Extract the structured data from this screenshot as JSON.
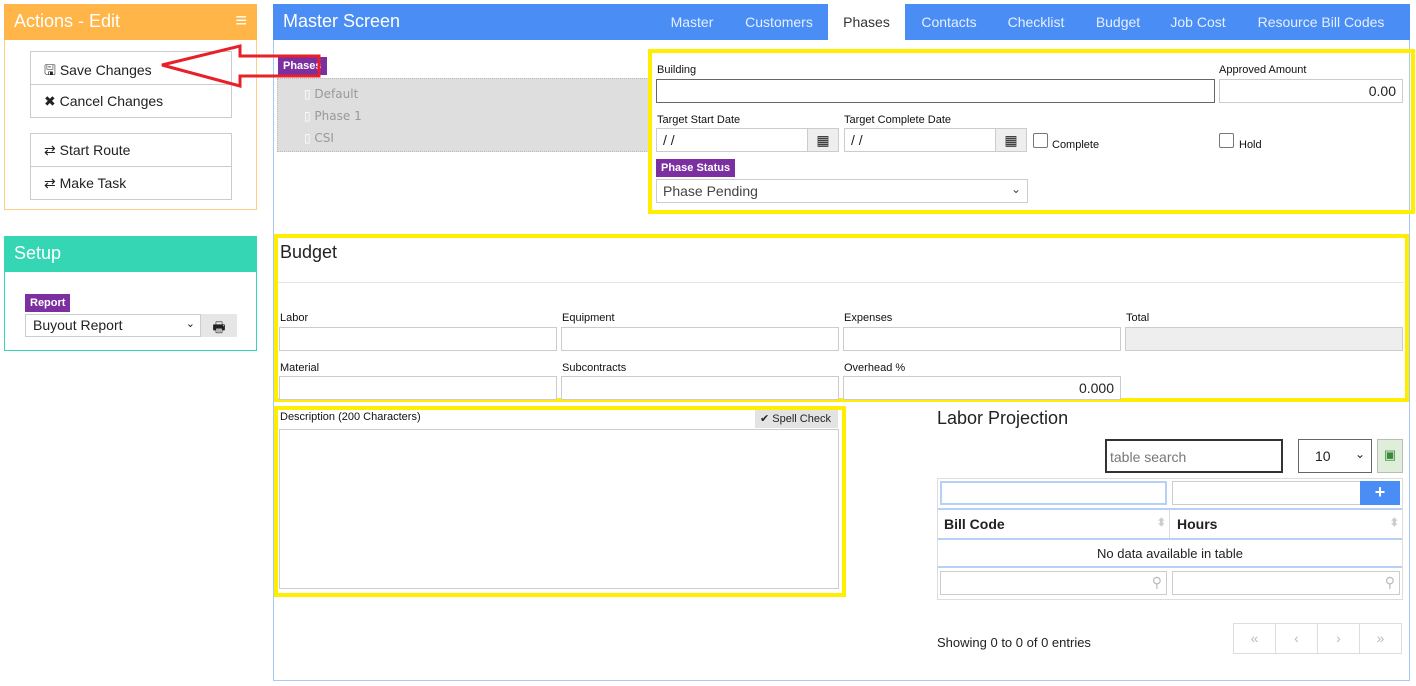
{
  "actions": {
    "title": "Actions - Edit",
    "buttons": [
      "Save Changes",
      "Cancel Changes",
      "Start Route",
      "Make Task"
    ],
    "color": "#ffb547"
  },
  "setup": {
    "title": "Setup",
    "report_label": "Report",
    "report_value": "Buyout Report",
    "color": "#35d6b4"
  },
  "main": {
    "title": "Master Screen",
    "color": "#4a8ef5",
    "tabs": [
      "Master",
      "Customers",
      "Phases",
      "Contacts",
      "Checklist",
      "Budget",
      "Job Cost",
      "Resource Bill Codes"
    ],
    "active_tab": "Phases"
  },
  "phases": {
    "label": "Phases",
    "items": [
      "Default",
      "Phase 1",
      "CSI"
    ]
  },
  "phase_form": {
    "building_label": "Building",
    "building_value": "",
    "approved_label": "Approved Amount",
    "approved_value": "0.00",
    "start_label": "Target Start Date",
    "start_value": " /  /",
    "complete_date_label": "Target Complete Date",
    "complete_date_value": " /  /",
    "complete_label": "Complete",
    "hold_label": "Hold",
    "status_label": "Phase Status",
    "status_value": "Phase Pending"
  },
  "budget": {
    "title": "Budget",
    "labor": "Labor",
    "equipment": "Equipment",
    "expenses": "Expenses",
    "total": "Total",
    "material": "Material",
    "subcontracts": "Subcontracts",
    "overhead": "Overhead %",
    "overhead_value": "0.000"
  },
  "description": {
    "label": "Description (200 Characters)",
    "spell_check": "Spell Check"
  },
  "labor": {
    "title": "Labor Projection",
    "search_placeholder": "table search",
    "page_size": "10",
    "columns": [
      "Bill Code",
      "Hours"
    ],
    "empty": "No data available in table",
    "info": "Showing 0 to 0 of 0 entries",
    "pager": [
      "«",
      "‹",
      "›",
      "»"
    ]
  }
}
